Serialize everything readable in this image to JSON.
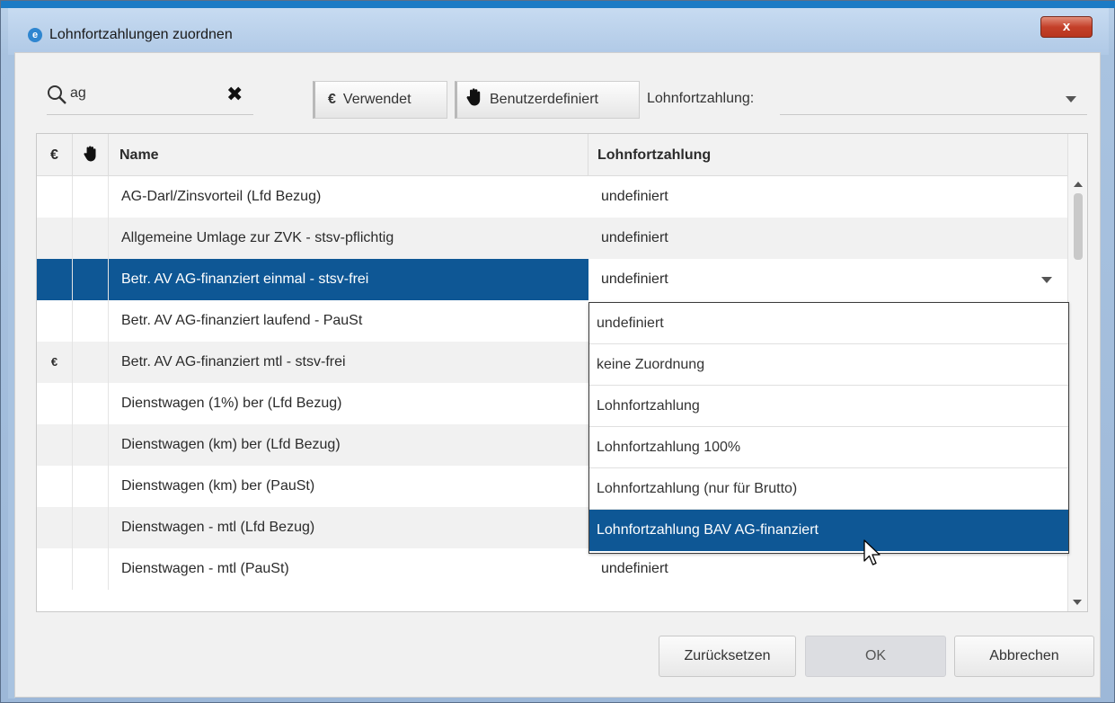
{
  "window": {
    "title": "Lohnfortzahlungen zuordnen",
    "close_label": "x"
  },
  "toolbar": {
    "search_value": "ag",
    "used_symbol": "€",
    "used_label": "Verwendet",
    "custom_label": "Benutzerdefiniert",
    "lf_label": "Lohnfortzahlung:",
    "lf_value": ""
  },
  "table": {
    "headers": {
      "euro": "€",
      "name": "Name",
      "lf": "Lohnfortzahlung"
    },
    "rows": [
      {
        "euro": "",
        "name": "AG-Darl/Zinsvorteil (Lfd Bezug)",
        "lf": "undefiniert"
      },
      {
        "euro": "",
        "name": "Allgemeine Umlage zur ZVK - stsv-pflichtig",
        "lf": "undefiniert"
      },
      {
        "euro": "",
        "name": "Betr. AV  AG-finanziert einmal - stsv-frei",
        "lf": "undefiniert"
      },
      {
        "euro": "",
        "name": "Betr. AV  AG-finanziert laufend - PauSt",
        "lf": ""
      },
      {
        "euro": "€",
        "name": "Betr. AV  AG-finanziert mtl - stsv-frei",
        "lf": ""
      },
      {
        "euro": "",
        "name": "Dienstwagen (1%) ber (Lfd Bezug)",
        "lf": ""
      },
      {
        "euro": "",
        "name": "Dienstwagen (km) ber (Lfd Bezug)",
        "lf": ""
      },
      {
        "euro": "",
        "name": "Dienstwagen (km) ber (PauSt)",
        "lf": ""
      },
      {
        "euro": "",
        "name": "Dienstwagen - mtl (Lfd Bezug)",
        "lf": ""
      },
      {
        "euro": "",
        "name": "Dienstwagen - mtl (PauSt)",
        "lf": "undefiniert"
      }
    ]
  },
  "dropdown": {
    "options": [
      "undefiniert",
      "keine Zuordnung",
      "Lohnfortzahlung",
      "Lohnfortzahlung 100%",
      "Lohnfortzahlung (nur für Brutto)",
      "Lohnfortzahlung BAV AG-finanziert"
    ]
  },
  "footer": {
    "reset_label": "Zurücksetzen",
    "ok_label": "OK",
    "cancel_label": "Abbrechen"
  },
  "colors": {
    "selection": "#0e5795",
    "title_close": "#c4402a"
  }
}
